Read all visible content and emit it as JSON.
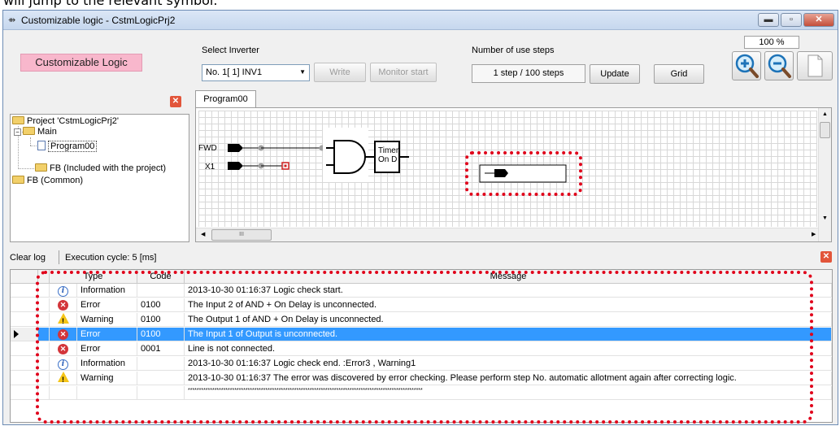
{
  "top_caption": "will jump to the relevant symbol.",
  "window": {
    "title": "Customizable logic - CstmLogicPrj2",
    "title_icon": "app-icon"
  },
  "toolbar": {
    "panel_label": "Customizable Logic",
    "select_inverter_label": "Select Inverter",
    "inverter_value": "No. 1[ 1] INV1",
    "write_label": "Write",
    "monitor_start_label": "Monitor start",
    "use_steps_label": "Number of use steps",
    "steps_value": "1 step / 100 steps",
    "update_label": "Update",
    "grid_label": "Grid",
    "zoom_value": "100 %"
  },
  "tree": {
    "items": [
      "Project 'CstmLogicPrj2'",
      "Main",
      "Program00",
      "FB (Included with the project)",
      "FB (Common)"
    ]
  },
  "editor": {
    "tab_label": "Program00",
    "input_fwd": "FWD",
    "input_x1": "X1",
    "timer_line1": "Timer",
    "timer_line2": "On D",
    "hscroll_thumb": "III"
  },
  "log": {
    "clear_label": "Clear log",
    "cycle_label": "Execution cycle:  5  [ms]",
    "columns": [
      "Type",
      "Code",
      "Message"
    ],
    "rows": [
      {
        "icon": "info-icon",
        "type": "Information",
        "code": "",
        "message": "2013-10-30 01:16:37 Logic check start."
      },
      {
        "icon": "error-icon",
        "type": "Error",
        "code": "0100",
        "message": "The Input 2 of AND + On Delay  is unconnected."
      },
      {
        "icon": "warning-icon",
        "type": "Warning",
        "code": "0100",
        "message": "The Output 1 of AND + On Delay  is unconnected."
      },
      {
        "icon": "error-icon",
        "type": "Error",
        "code": "0100",
        "message": "The Input 1 of Output  is unconnected."
      },
      {
        "icon": "error-icon",
        "type": "Error",
        "code": "0001",
        "message": "Line is not connected."
      },
      {
        "icon": "info-icon",
        "type": "Information",
        "code": "",
        "message": "2013-10-30 01:16:37 Logic check end.  :Error3 , Warning1"
      },
      {
        "icon": "warning-icon",
        "type": "Warning",
        "code": "",
        "message": "2013-10-30 01:16:37 The error was discovered by error checking. Please perform step No. automatic allotment again after correcting logic."
      },
      {
        "icon": "",
        "type": "",
        "code": "",
        "message": "**********************************************************************************************************"
      }
    ]
  },
  "colors": {
    "panel_pink": "#f8b7cc",
    "highlight_red": "#e0001a",
    "selection_blue": "#3399ff"
  }
}
